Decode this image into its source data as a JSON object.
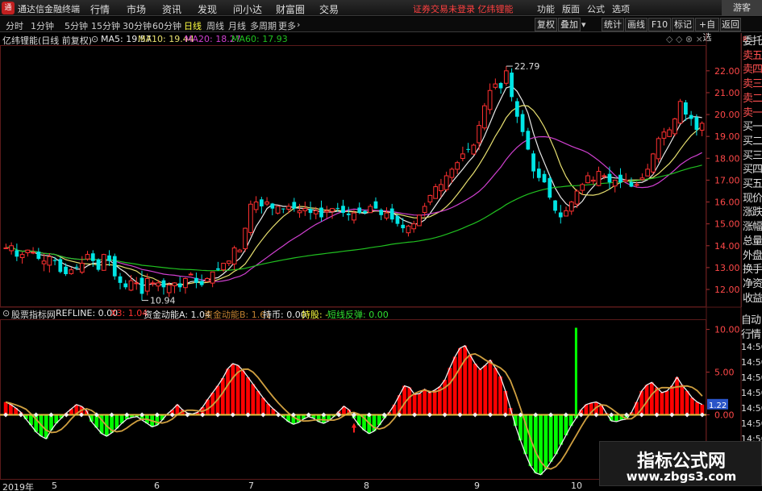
{
  "menubar": {
    "logo_text": "通",
    "app_title": "通达信金融终端",
    "menus": [
      "行情",
      "市场",
      "资讯",
      "发现",
      "问小达",
      "财富圈",
      "交易"
    ],
    "warning": "证券交易未登录  亿纬锂能",
    "right_menus": [
      "功能",
      "版面",
      "公式",
      "选项"
    ],
    "guest": "游客"
  },
  "periodbar": {
    "periods": [
      "分时",
      "1分钟",
      "5分钟",
      "15分钟",
      "30分钟",
      "60分钟",
      "日线",
      "周线",
      "月线",
      "多周期",
      "更多"
    ],
    "active": "日线",
    "right_buttons": [
      "复权",
      "叠加",
      "统计",
      "画线",
      "F10",
      "标记",
      "+自选",
      "返回"
    ]
  },
  "chart_title": {
    "name": "亿纬锂能(日线 前复权)",
    "ma5": "MA5: 19.57",
    "ma10": "MA10: 19.44",
    "ma20": "MA20: 18.27",
    "ma60": "MA60: 17.93",
    "controls": "◇ ◇ ⊗ ×"
  },
  "right_panel": {
    "r_label": "R",
    "items": [
      "委托",
      "卖五",
      "卖四",
      "卖三",
      "卖二",
      "卖一",
      "买一",
      "买二",
      "买三",
      "买四",
      "买五",
      "现价",
      "涨跌",
      "涨幅",
      "总量",
      "外盘",
      "换手",
      "净资",
      "收益"
    ]
  },
  "indicator_header": {
    "name": "股票指标网",
    "refline": "REFLINE: 0.00",
    "x3": "X3: 1.04",
    "zjA": "资金动能A: 1.04",
    "zjB": "资金动能B: 1.61",
    "chibi": "持币: 0.00",
    "chigu": "持股: -",
    "duanxian": "短线反弹: 0.00"
  },
  "right_panel2": {
    "items": [
      "自动",
      "行情"
    ],
    "times": [
      "14:50",
      "14:50",
      "14:50",
      "14:50",
      "14:50",
      "14:50",
      "14:50"
    ]
  },
  "time_axis": {
    "labels": [
      "2019年",
      "5",
      "6",
      "7",
      "8",
      "9",
      "10"
    ]
  },
  "watermark": {
    "line1": "指标公式网",
    "line2": "www.zbgs3.com"
  },
  "colors": {
    "up": "#ff3030",
    "down": "#00e5e5",
    "ma5": "#e8e8e8",
    "ma10": "#e8e070",
    "ma20": "#d040d0",
    "ma60": "#20c020",
    "hist_up": "#ff0000",
    "hist_down": "#00ff00",
    "indicator_line": "#d0a040"
  },
  "chart_data": [
    {
      "type": "candlestick",
      "title": "亿纬锂能(日线 前复权)",
      "y_ticks": [
        "22.00",
        "21.00",
        "20.00",
        "19.00",
        "18.00",
        "17.00",
        "16.00",
        "15.00",
        "14.00",
        "13.00",
        "12.00"
      ],
      "ylim": [
        11.3,
        23.1
      ],
      "annotations": {
        "high": "22.79",
        "low": "10.94"
      },
      "close_series": [
        13.9,
        14.0,
        13.5,
        13.6,
        13.8,
        13.7,
        13.4,
        13.3,
        13.5,
        13.3,
        12.8,
        12.7,
        12.9,
        13.0,
        13.2,
        13.6,
        13.3,
        12.9,
        13.6,
        13.3,
        12.6,
        12.3,
        12.1,
        12.4,
        12.3,
        11.8,
        12.5,
        12.3,
        12.3,
        12.1,
        12.2,
        12.3,
        12.1,
        12.5,
        12.7,
        12.3,
        12.2,
        12.5,
        12.8,
        12.9,
        13.2,
        13.3,
        13.9,
        13.8,
        14.8,
        15.9,
        16.0,
        15.8,
        16.0,
        15.7,
        15.8,
        15.7,
        15.8,
        15.7,
        15.6,
        15.7,
        15.5,
        15.6,
        15.3,
        15.6,
        15.7,
        15.7,
        15.5,
        15.4,
        15.5,
        15.5,
        15.5,
        15.8,
        15.7,
        15.4,
        15.5,
        15.2,
        15.0,
        14.8,
        14.9,
        15.0,
        15.4,
        15.8,
        16.3,
        16.7,
        16.8,
        17.2,
        17.5,
        17.8,
        18.2,
        18.4,
        18.6,
        19.5,
        20.4,
        21.1,
        21.4,
        21.2,
        22.0,
        20.8,
        19.9,
        19.2,
        18.4,
        17.4,
        17.1,
        16.9,
        16.2,
        15.6,
        15.3,
        15.6,
        16.0,
        16.5,
        16.8,
        17.2,
        17.0,
        17.4,
        17.2,
        16.9,
        17.0,
        16.9,
        17.0,
        16.7,
        16.8,
        17.1,
        17.5,
        18.2,
        18.9,
        19.2,
        19.3,
        19.8,
        20.6,
        20.0,
        19.8,
        19.3,
        19.6
      ],
      "ma5": "MA5: 19.57",
      "ma10": "MA10: 19.44",
      "ma20": "MA20: 18.27",
      "ma60": "MA60: 17.93"
    },
    {
      "type": "bar",
      "title": "股票指标网",
      "y_ticks": [
        "10.00",
        "5.00",
        "0.00",
        "-5.00"
      ],
      "ylim": [
        -7.5,
        11
      ],
      "current_value_label": "1.22",
      "values": [
        1.5,
        1.2,
        0.8,
        0.3,
        -0.5,
        -1.2,
        -2.0,
        -2.5,
        -2.8,
        -1.8,
        -1.0,
        -0.4,
        0.2,
        0.7,
        1.2,
        1.0,
        0.5,
        -0.8,
        -1.5,
        -2.2,
        -2.5,
        -2.1,
        -1.6,
        -1.0,
        -0.5,
        -0.3,
        -0.2,
        -0.6,
        -1.0,
        -1.4,
        -1.2,
        -0.6,
        0.1,
        0.6,
        1.2,
        0.6,
        0.2,
        0.1,
        0.3,
        0.9,
        1.8,
        2.6,
        3.4,
        4.3,
        5.4,
        6.0,
        5.8,
        5.2,
        4.4,
        3.6,
        2.8,
        2.0,
        1.3,
        0.7,
        0.2,
        -0.3,
        -0.8,
        -1.1,
        -0.9,
        -0.5,
        -0.2,
        -0.4,
        -0.8,
        -1.0,
        -0.7,
        -0.2,
        0.4,
        1.0,
        0.6,
        -0.4,
        -1.2,
        -1.8,
        -2.2,
        -1.9,
        -1.2,
        -0.4,
        0.3,
        1.2,
        2.3,
        3.4,
        3.2,
        2.4,
        2.5,
        3.0,
        2.6,
        2.9,
        3.3,
        4.1,
        5.5,
        6.8,
        7.8,
        8.1,
        7.0,
        6.0,
        5.3,
        5.8,
        6.4,
        5.5,
        4.5,
        2.8,
        0.8,
        -1.3,
        -3.0,
        -4.6,
        -6.0,
        -6.8,
        -7.0,
        -6.4,
        -5.5,
        -4.6,
        -3.5,
        -2.4,
        -1.3,
        -0.4,
        0.6,
        1.2,
        1.4,
        1.5,
        1.2,
        0.2,
        -0.7,
        -0.8,
        -0.6,
        -0.5,
        0.3,
        1.5,
        2.8,
        3.5,
        3.8,
        3.2,
        2.6,
        2.8,
        3.4,
        4.4,
        3.5,
        2.8,
        2.0,
        1.5,
        1.2
      ]
    }
  ]
}
